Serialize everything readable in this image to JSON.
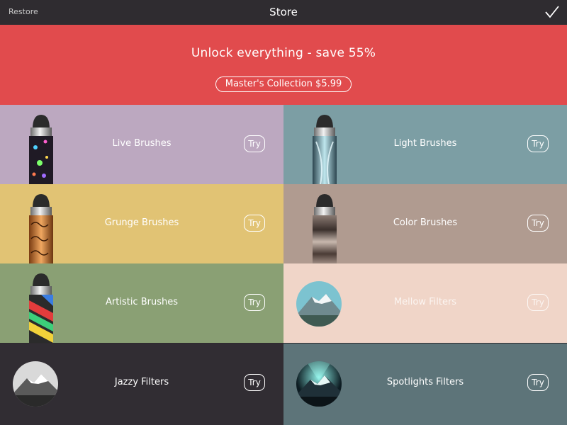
{
  "header": {
    "restore_label": "Restore",
    "title": "Store",
    "done_icon": "checkmark-icon"
  },
  "banner": {
    "headline": "Unlock everything - save 55%",
    "button_label": "Master's Collection $5.99",
    "color": "#e14b4d"
  },
  "items": [
    {
      "label": "Live Brushes",
      "try_label": "Try",
      "bg": "#bca8c0",
      "thumb": "live-brush-stylus-icon"
    },
    {
      "label": "Light Brushes",
      "try_label": "Try",
      "bg": "#7c9ea4",
      "thumb": "light-brush-stylus-icon"
    },
    {
      "label": "Grunge Brushes",
      "try_label": "Try",
      "bg": "#e1c374",
      "thumb": "grunge-brush-stylus-icon"
    },
    {
      "label": "Color Brushes",
      "try_label": "Try",
      "bg": "#b09b90",
      "thumb": "color-brush-stylus-icon"
    },
    {
      "label": "Artistic Brushes",
      "try_label": "Try",
      "bg": "#8aa074",
      "thumb": "artistic-brush-stylus-icon"
    },
    {
      "label": "Mellow Filters",
      "try_label": "Try",
      "bg": "#f0d5c8",
      "thumb": "mountain-photo-mellow-icon"
    },
    {
      "label": "Jazzy Filters",
      "try_label": "Try",
      "bg": "#312d33",
      "thumb": "mountain-photo-bw-icon"
    },
    {
      "label": "Spotlights Filters",
      "try_label": "Try",
      "bg": "#5d7479",
      "thumb": "mountain-photo-spotlight-icon"
    }
  ]
}
